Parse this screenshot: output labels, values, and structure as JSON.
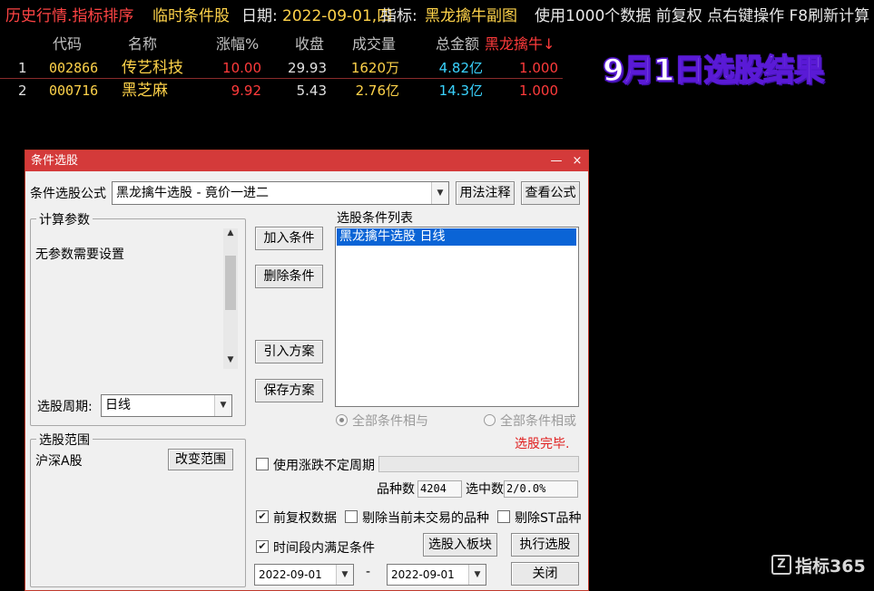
{
  "topbar": {
    "title": "历史行情.指标排序",
    "mode": "临时条件股",
    "date_label": "日期:",
    "date_value": "2022-09-01,四",
    "indicator_label": "指标:",
    "indicator_value": "黑龙擒牛副图",
    "data_info": "使用1000个数据 前复权 点右键操作 F8刷新计算"
  },
  "table": {
    "headers": {
      "code": "代码",
      "name": "名称",
      "change": "涨幅%",
      "close": "收盘",
      "volume": "成交量",
      "amount": "总金额",
      "indicator": "黑龙擒牛↓"
    },
    "rows": [
      {
        "index": "1",
        "code": "002866",
        "name": "传艺科技",
        "change": "10.00",
        "close": "29.93",
        "volume": "1620万",
        "amount": "4.82亿",
        "indicator": "1.000"
      },
      {
        "index": "2",
        "code": "000716",
        "name": "黑芝麻",
        "change": "9.92",
        "close": "5.43",
        "volume": "2.76亿",
        "amount": "14.3亿",
        "indicator": "1.000"
      }
    ]
  },
  "promo_text": "9月1日选股结果",
  "watermark": "指标365",
  "dialog": {
    "title": "条件选股",
    "minimize": "—",
    "close": "×",
    "formula_label": "条件选股公式",
    "formula_value": "黑龙擒牛选股 - 竟价一进二",
    "usage_button": "用法注释",
    "view_formula_button": "查看公式",
    "params_group": "计算参数",
    "params_text": "无参数需要设置",
    "period_label": "选股周期:",
    "period_value": "日线",
    "add_condition": "加入条件",
    "delete_condition": "删除条件",
    "import_plan": "引入方案",
    "save_plan": "保存方案",
    "conditions_list_label": "选股条件列表",
    "conditions": [
      "黑龙擒牛选股  日线"
    ],
    "radio_and": "全部条件相与",
    "radio_or": "全部条件相或",
    "status": "选股完毕.",
    "range_group": "选股范围",
    "range_value": "沪深A股",
    "change_range": "改变范围",
    "indef_period": "使用涨跌不定周期",
    "variety_count_label": "品种数",
    "variety_count": "4204",
    "selected_count_label": "选中数",
    "selected_count": "2/0.0%",
    "opt_adjust": "前复权数据",
    "opt_exclude_untraded": "剔除当前未交易的品种",
    "opt_exclude_st": "剔除ST品种",
    "opt_timespan": "时间段内满足条件",
    "to_block_button": "选股入板块",
    "execute_button": "执行选股",
    "close_button": "关闭",
    "date_from": "2022-09-01",
    "date_sep": "-",
    "date_to": "2022-09-01"
  },
  "colors": {
    "accent_red": "#d43a3a",
    "up_red": "#ff3b3b",
    "gold": "#ffd34a",
    "cyan": "#3ad3ff",
    "promo_purple": "#5a1ad6"
  }
}
